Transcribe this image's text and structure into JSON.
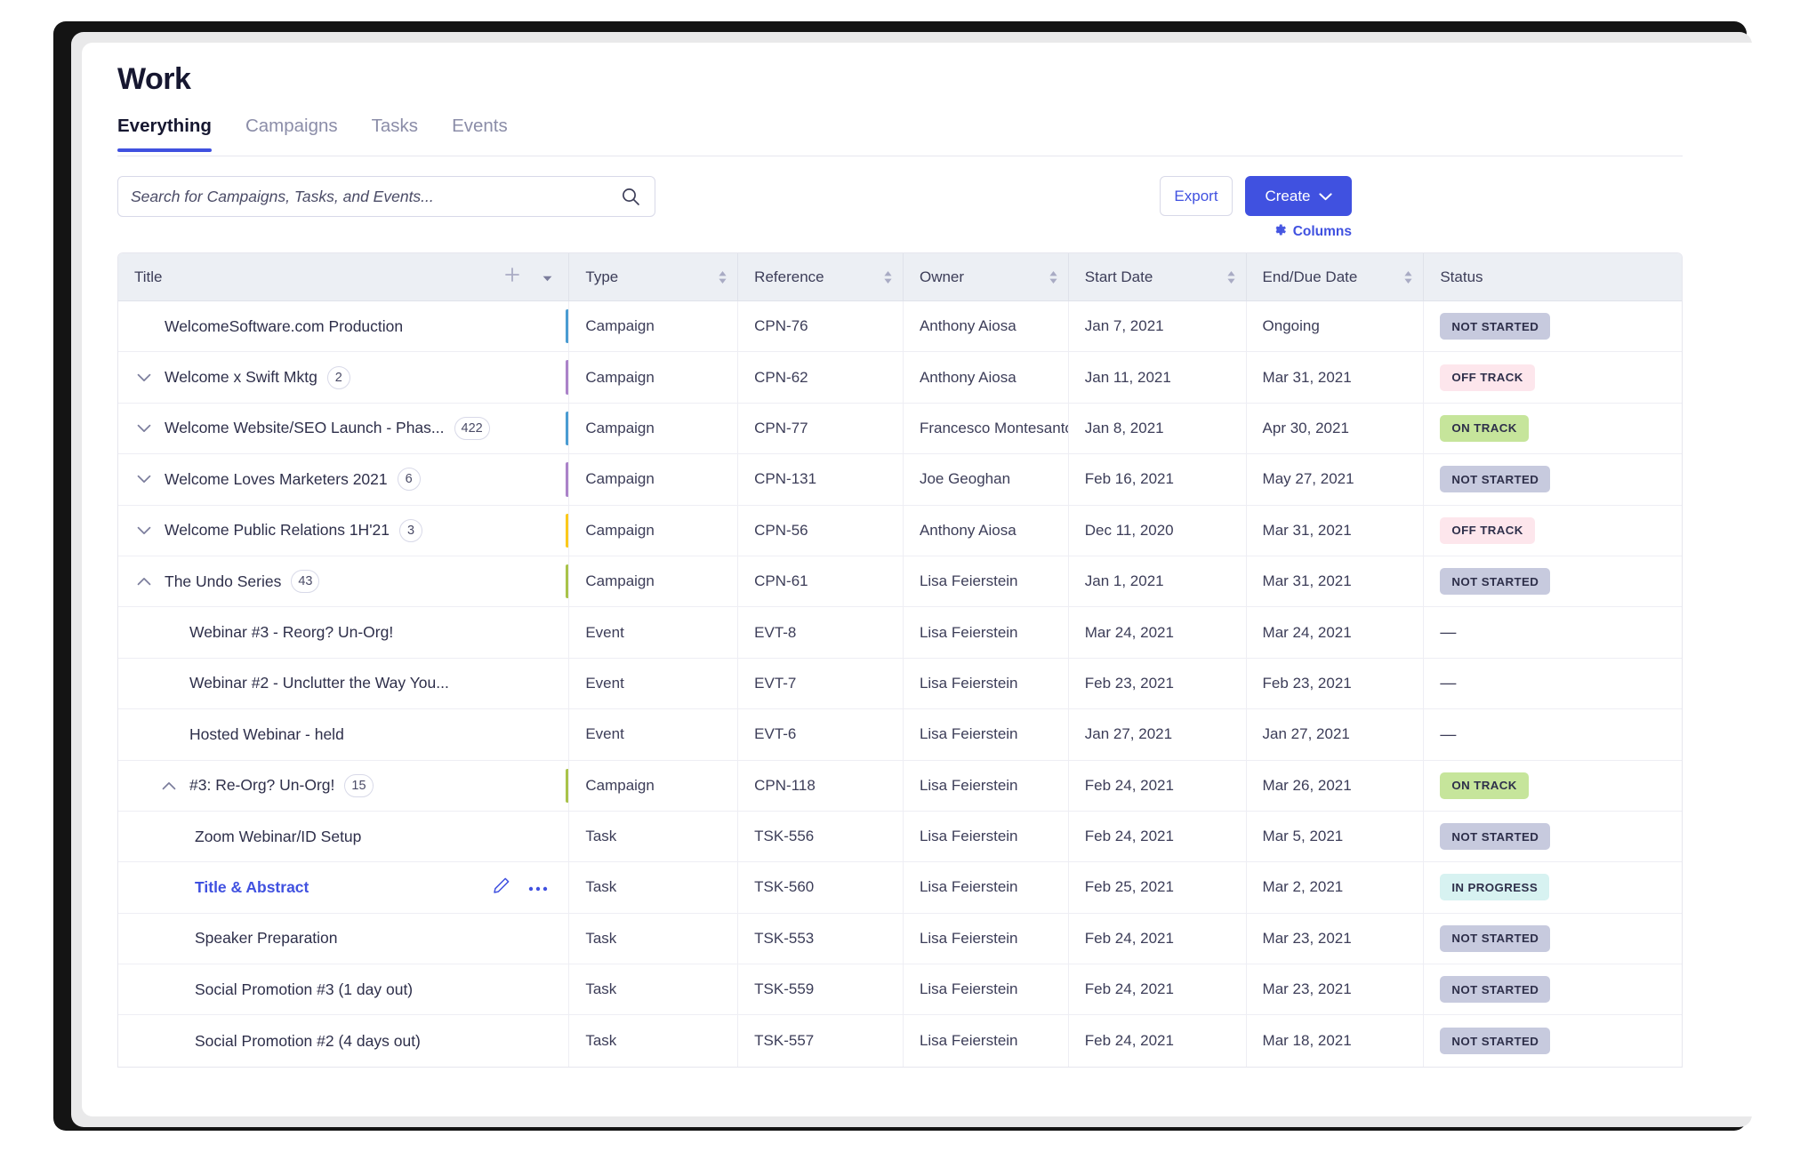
{
  "app": {
    "title": "Work",
    "accent": "#4051e0"
  },
  "tabs": [
    {
      "label": "Everything",
      "active": true
    },
    {
      "label": "Campaigns",
      "active": false
    },
    {
      "label": "Tasks",
      "active": false
    },
    {
      "label": "Events",
      "active": false
    }
  ],
  "toolbar": {
    "search_placeholder": "Search for Campaigns, Tasks, and Events...",
    "search_value": "",
    "search_icon": "search-icon",
    "export_label": "Export",
    "create_label": "Create",
    "create_caret_icon": "chevron-down-icon",
    "columns_label": "Columns",
    "columns_icon": "gear-icon"
  },
  "table": {
    "columns": [
      {
        "label": "Title",
        "sortable": false,
        "has_add": true
      },
      {
        "label": "Type",
        "sortable": true
      },
      {
        "label": "Reference",
        "sortable": true
      },
      {
        "label": "Owner",
        "sortable": true
      },
      {
        "label": "Start Date",
        "sortable": true
      },
      {
        "label": "End/Due Date",
        "sortable": true
      },
      {
        "label": "Status",
        "sortable": false
      }
    ],
    "status_colors": {
      "NOT STARTED": "#c7cade",
      "OFF TRACK": "#fde6ec",
      "ON TRACK": "#c6e59b",
      "IN PROGRESS": "#d7f2f1"
    },
    "rows": [
      {
        "title": "WelcomeSoftware.com Production",
        "count": null,
        "chevron": "none",
        "indent": 0,
        "bar": "#4a9cd2",
        "type": "Campaign",
        "reference": "CPN-76",
        "owner": "Anthony Aiosa",
        "start": "Jan 7, 2021",
        "end": "Ongoing",
        "status": "NOT STARTED"
      },
      {
        "title": "Welcome x Swift Mktg",
        "count": "2",
        "chevron": "down",
        "indent": 0,
        "bar": "#ab82c9",
        "type": "Campaign",
        "reference": "CPN-62",
        "owner": "Anthony Aiosa",
        "start": "Jan 11, 2021",
        "end": "Mar 31, 2021",
        "status": "OFF TRACK"
      },
      {
        "title": "Welcome Website/SEO Launch - Phas...",
        "count": "422",
        "chevron": "down",
        "indent": 0,
        "bar": "#4a9cd2",
        "type": "Campaign",
        "reference": "CPN-77",
        "owner": "Francesco Montesanto",
        "start": "Jan 8, 2021",
        "end": "Apr 30, 2021",
        "status": "ON TRACK"
      },
      {
        "title": "Welcome Loves Marketers 2021",
        "count": "6",
        "chevron": "down",
        "indent": 0,
        "bar": "#ab82c9",
        "type": "Campaign",
        "reference": "CPN-131",
        "owner": "Joe Geoghan",
        "start": "Feb 16, 2021",
        "end": "May 27, 2021",
        "status": "NOT STARTED"
      },
      {
        "title": "Welcome Public Relations 1H'21",
        "count": "3",
        "chevron": "down",
        "indent": 0,
        "bar": "#fbc91b",
        "type": "Campaign",
        "reference": "CPN-56",
        "owner": "Anthony Aiosa",
        "start": "Dec 11, 2020",
        "end": "Mar 31, 2021",
        "status": "OFF TRACK"
      },
      {
        "title": "The Undo Series",
        "count": "43",
        "chevron": "up",
        "indent": 0,
        "bar": "#a9c34a",
        "type": "Campaign",
        "reference": "CPN-61",
        "owner": "Lisa Feierstein",
        "start": "Jan 1, 2021",
        "end": "Mar 31, 2021",
        "status": "NOT STARTED"
      },
      {
        "title": "Webinar #3 - Reorg? Un-Org!",
        "count": null,
        "chevron": "none",
        "indent": 1,
        "bar": null,
        "type": "Event",
        "reference": "EVT-8",
        "owner": "Lisa Feierstein",
        "start": "Mar 24, 2021",
        "end": "Mar 24, 2021",
        "status": "—"
      },
      {
        "title": "Webinar #2 - Unclutter the Way You...",
        "count": null,
        "chevron": "none",
        "indent": 1,
        "bar": null,
        "type": "Event",
        "reference": "EVT-7",
        "owner": "Lisa Feierstein",
        "start": "Feb 23, 2021",
        "end": "Feb 23, 2021",
        "status": "—"
      },
      {
        "title": "Hosted Webinar - held",
        "count": null,
        "chevron": "none",
        "indent": 1,
        "bar": null,
        "type": "Event",
        "reference": "EVT-6",
        "owner": "Lisa Feierstein",
        "start": "Jan 27, 2021",
        "end": "Jan 27, 2021",
        "status": "—"
      },
      {
        "title": "#3: Re-Org? Un-Org!",
        "count": "15",
        "chevron": "up",
        "indent": 1,
        "bar": "#a9c34a",
        "type": "Campaign",
        "reference": "CPN-118",
        "owner": "Lisa Feierstein",
        "start": "Feb 24, 2021",
        "end": "Mar 26, 2021",
        "status": "ON TRACK"
      },
      {
        "title": "Zoom Webinar/ID Setup",
        "count": null,
        "chevron": "none",
        "indent": 2,
        "bar": null,
        "type": "Task",
        "reference": "TSK-556",
        "owner": "Lisa Feierstein",
        "start": "Feb 24, 2021",
        "end": "Mar 5, 2021",
        "status": "NOT STARTED"
      },
      {
        "title": "Title & Abstract",
        "count": null,
        "chevron": "none",
        "indent": 2,
        "bar": null,
        "highlighted": true,
        "actions": [
          "pencil-icon",
          "ellipsis-icon"
        ],
        "type": "Task",
        "reference": "TSK-560",
        "owner": "Lisa Feierstein",
        "start": "Feb 25, 2021",
        "end": "Mar 2, 2021",
        "status": "IN PROGRESS"
      },
      {
        "title": "Speaker Preparation",
        "count": null,
        "chevron": "none",
        "indent": 2,
        "bar": null,
        "type": "Task",
        "reference": "TSK-553",
        "owner": "Lisa Feierstein",
        "start": "Feb 24, 2021",
        "end": "Mar 23, 2021",
        "status": "NOT STARTED"
      },
      {
        "title": "Social Promotion #3 (1 day out)",
        "count": null,
        "chevron": "none",
        "indent": 2,
        "bar": null,
        "type": "Task",
        "reference": "TSK-559",
        "owner": "Lisa Feierstein",
        "start": "Feb 24, 2021",
        "end": "Mar 23, 2021",
        "status": "NOT STARTED"
      },
      {
        "title": "Social Promotion #2 (4 days out)",
        "count": null,
        "chevron": "none",
        "indent": 2,
        "bar": null,
        "type": "Task",
        "reference": "TSK-557",
        "owner": "Lisa Feierstein",
        "start": "Feb 24, 2021",
        "end": "Mar 18, 2021",
        "status": "NOT STARTED"
      }
    ]
  }
}
